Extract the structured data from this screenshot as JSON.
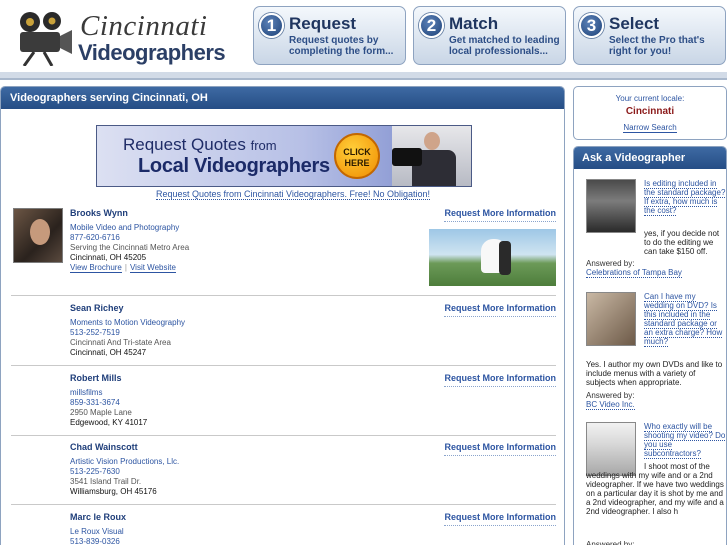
{
  "header": {
    "logo_line1": "Cincinnati",
    "logo_line2": "Videographers",
    "steps": [
      {
        "num": "1",
        "title": "Request",
        "desc": "Request quotes by completing the form..."
      },
      {
        "num": "2",
        "title": "Match",
        "desc": "Get matched to leading local professionals..."
      },
      {
        "num": "3",
        "title": "Select",
        "desc": "Select the Pro that's right for you!"
      }
    ]
  },
  "main": {
    "title": "Videographers serving Cincinnati, OH",
    "banner": {
      "line1": "Request Quotes",
      "line1_small": "from",
      "line2": "Local Videographers",
      "button_line1": "CLICK",
      "button_line2": "HERE"
    },
    "banner_caption": "Request Quotes from Cincinnati Videographers. Free! No Obligation!",
    "more_label": "Request More Information",
    "listings": [
      {
        "name": "Brooks Wynn",
        "company": "Mobile Video and Photography",
        "phone": "877-620-6716",
        "address1": "Serving the Cincinnati Metro Area",
        "address2": "Cincinnati, OH 45205",
        "brochure": "View Brochure",
        "website": "Visit Website"
      },
      {
        "name": "Sean Richey",
        "company": "Moments to Motion Videography",
        "phone": "513-252-7519",
        "address1": "Cincinnati And Tri-state Area",
        "address2": "Cincinnati, OH 45247"
      },
      {
        "name": "Robert Mills",
        "company": "millsfilms",
        "phone": "859-331-3674",
        "address1": "2950 Maple Lane",
        "address2": "Edgewood, KY 41017"
      },
      {
        "name": "Chad Wainscott",
        "company": "Artistic Vision Productions, Llc.",
        "phone": "513-225-7630",
        "address1": "3541 Island Trail Dr.",
        "address2": "Williamsburg, OH 45176"
      },
      {
        "name": "Marc le Roux",
        "company": "Le Roux Visual",
        "phone": "513-839-0326"
      }
    ]
  },
  "sidebar": {
    "locale_label": "Your current locale:",
    "locale_city": "Cincinnati",
    "narrow_search": "Narrow Search",
    "ask_title": "Ask a Videographer",
    "answered_by_label": "Answered by:",
    "qa": [
      {
        "question": "Is editing included in the standard package? If extra, how much is the cost?",
        "answer": "yes, if you decide not to do the editing we can take $150 off.",
        "answered_by": "Celebrations of Tampa Bay"
      },
      {
        "question": "Can I have my wedding on DVD? Is this included in the standard package or an extra charge? How much?",
        "answer": "Yes. I author my own DVDs and like to include menus with a variety of subjects when appropriate.",
        "answered_by": "BC Video Inc."
      },
      {
        "question": "Who exactly will be shooting my video? Do you use subcontractors?",
        "answer": "I shoot most of the weddings with my wife and or a 2nd videographer. If we have two weddings on a particular day it is shot by me and a 2nd videographer, and my wife and a 2nd videographer. I also h"
      }
    ]
  }
}
